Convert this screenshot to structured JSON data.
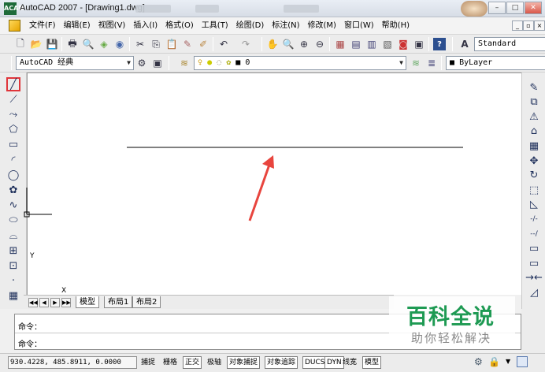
{
  "window": {
    "title": "AutoCAD 2007 - [Drawing1.dwg]",
    "app_icon_label": "ACAD",
    "minimize": "–",
    "maximize": "□",
    "close": "✕",
    "mdi_min": "_",
    "mdi_max": "▫",
    "mdi_close": "×"
  },
  "menubar": {
    "items": [
      "文件(F)",
      "编辑(E)",
      "视图(V)",
      "插入(I)",
      "格式(O)",
      "工具(T)",
      "绘图(D)",
      "标注(N)",
      "修改(M)",
      "窗口(W)",
      "帮助(H)"
    ]
  },
  "toolbar1": {
    "text_style": "Standard"
  },
  "toolbar2": {
    "workspace": "AutoCAD 经典",
    "layer_label": "0",
    "color_value": "ByLayer"
  },
  "icons": {
    "new": "🗋",
    "open": "📂",
    "save": "💾",
    "print": "🖶",
    "preview": "🔍",
    "cut": "✂",
    "copy": "⎘",
    "paste": "📋",
    "undo": "↶",
    "redo": "↷",
    "pan": "✋",
    "zoom": "🔍",
    "help": "?",
    "text_style": "A"
  },
  "left_tools": [
    "╱",
    "⟋",
    "⤳",
    "⬠",
    "▭",
    "◜",
    "◯",
    "✿",
    "∿",
    "⬭",
    "⌓",
    "⊞",
    "⊡",
    "·",
    "▦"
  ],
  "right_tools": [
    "✎",
    "⧉",
    "⚠",
    "⌂",
    "▦",
    "✥",
    "↻",
    "⬚",
    "◺",
    "-/-",
    "--/",
    "▭",
    "▭",
    "→←",
    "◿"
  ],
  "ucs": {
    "x_label": "X",
    "y_label": "Y"
  },
  "tabs": {
    "nav": [
      "◀◀",
      "◀",
      "▶",
      "▶▶"
    ],
    "items": [
      "模型",
      "布局1",
      "布局2"
    ]
  },
  "command": {
    "line1": "命令：",
    "line2": "命令："
  },
  "status": {
    "coords": "930.4228,  485.8911,  0.0000",
    "buttons": [
      "捕捉",
      "栅格",
      "正交",
      "极轴",
      "对象捕捉",
      "对象追踪",
      "DUCS",
      "DYN",
      "线宽",
      "模型"
    ]
  },
  "watermark": {
    "title": "百科全说",
    "subtitle": "助你轻松解决"
  },
  "colors": {
    "highlight": "#e0353a",
    "arrow": "#e8453e",
    "watermark_green": "#1e9a53"
  }
}
